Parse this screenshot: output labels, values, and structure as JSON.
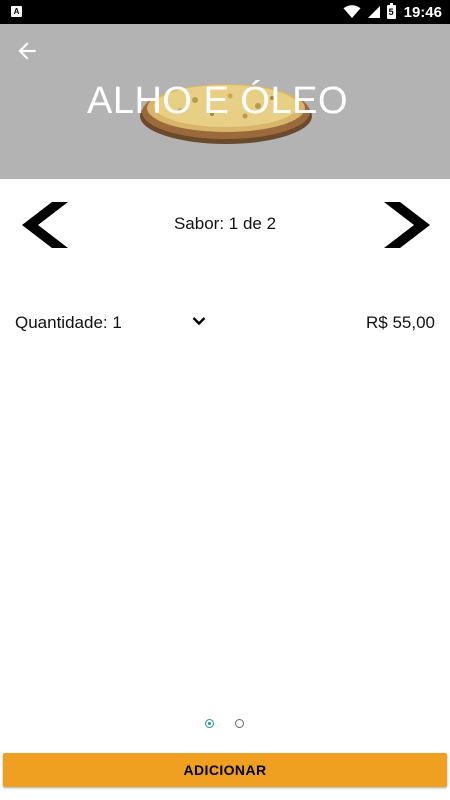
{
  "status_bar": {
    "app_icon_letter": "A",
    "battery_text": "5",
    "time": "19:46"
  },
  "header": {
    "title": "ALHO E ÓLEO",
    "background_color": "#b3b3b3"
  },
  "flavor": {
    "label": "Sabor: 1 de 2"
  },
  "quantity": {
    "label": "Quantidade: 1"
  },
  "price": "R$ 55,00",
  "pager": {
    "pages": 2,
    "active_index": 0
  },
  "add_button": {
    "label": "ADICIONAR",
    "color": "#f0a021"
  },
  "icons": [
    "back-arrow-icon",
    "chevron-left-icon",
    "chevron-right-icon",
    "chevron-down-icon",
    "wifi-icon",
    "signal-icon",
    "battery-icon"
  ]
}
